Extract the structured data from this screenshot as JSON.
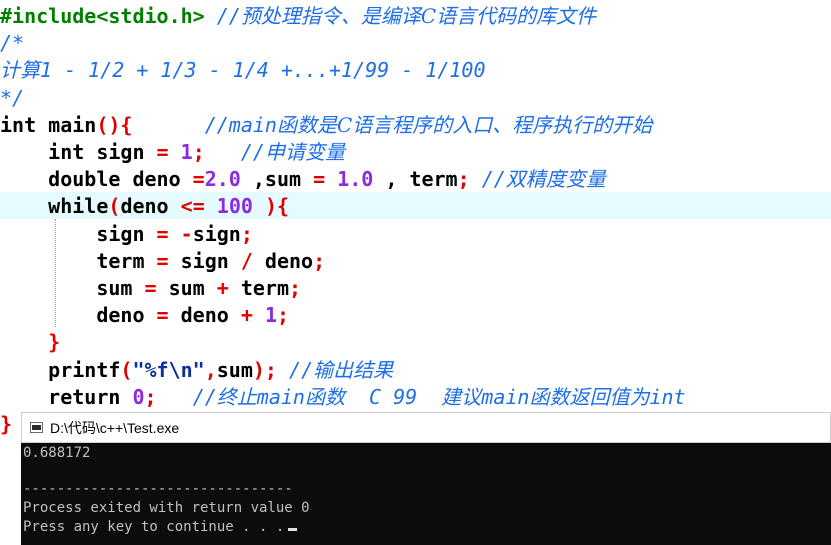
{
  "editor": {
    "lines": [
      {
        "tokens": [
          {
            "c": "pp",
            "t": "#include<stdio.h>"
          },
          {
            "c": "tx",
            "t": " "
          },
          {
            "c": "cm",
            "t": "//"
          },
          {
            "c": "cmz",
            "t": "预处理指令、是编译C语言代码的库文件"
          }
        ]
      },
      {
        "tokens": [
          {
            "c": "cm",
            "t": "/*"
          }
        ]
      },
      {
        "tokens": [
          {
            "c": "cmz",
            "t": "计算"
          },
          {
            "c": "cm",
            "t": "1 - 1/2 + 1/3 - 1/4 +...+1/99 - 1/100"
          }
        ]
      },
      {
        "tokens": [
          {
            "c": "cm",
            "t": "*/"
          }
        ]
      },
      {
        "tokens": [
          {
            "c": "kw",
            "t": "int"
          },
          {
            "c": "tx",
            "t": " main"
          },
          {
            "c": "op",
            "t": "(){"
          },
          {
            "c": "tx",
            "t": "      "
          },
          {
            "c": "cm",
            "t": "//main"
          },
          {
            "c": "cmz",
            "t": "函数是C语言程序的入口、程序执行的开始"
          }
        ]
      },
      {
        "tokens": [
          {
            "c": "tx",
            "t": "    "
          },
          {
            "c": "kw",
            "t": "int"
          },
          {
            "c": "tx",
            "t": " sign "
          },
          {
            "c": "op",
            "t": "="
          },
          {
            "c": "tx",
            "t": " "
          },
          {
            "c": "nm",
            "t": "1"
          },
          {
            "c": "op",
            "t": ";"
          },
          {
            "c": "tx",
            "t": "   "
          },
          {
            "c": "cm",
            "t": "//"
          },
          {
            "c": "cmz",
            "t": "申请变量"
          }
        ]
      },
      {
        "tokens": [
          {
            "c": "tx",
            "t": "    "
          },
          {
            "c": "kw",
            "t": "double"
          },
          {
            "c": "tx",
            "t": " deno "
          },
          {
            "c": "op",
            "t": "="
          },
          {
            "c": "nm",
            "t": "2.0"
          },
          {
            "c": "tx",
            "t": " ,sum "
          },
          {
            "c": "op",
            "t": "="
          },
          {
            "c": "tx",
            "t": " "
          },
          {
            "c": "nm",
            "t": "1.0"
          },
          {
            "c": "tx",
            "t": " , term"
          },
          {
            "c": "op",
            "t": ";"
          },
          {
            "c": "tx",
            "t": " "
          },
          {
            "c": "cm",
            "t": "//"
          },
          {
            "c": "cmz",
            "t": "双精度变量"
          }
        ]
      },
      {
        "tokens": [
          {
            "c": "tx",
            "t": "    "
          },
          {
            "c": "kw",
            "t": "while"
          },
          {
            "c": "op",
            "t": "("
          },
          {
            "c": "tx",
            "t": "deno "
          },
          {
            "c": "op",
            "t": "<="
          },
          {
            "c": "tx",
            "t": " "
          },
          {
            "c": "nm",
            "t": "100"
          },
          {
            "c": "tx",
            "t": " "
          },
          {
            "c": "op",
            "t": "){"
          }
        ]
      },
      {
        "tokens": [
          {
            "c": "tx",
            "t": "        sign "
          },
          {
            "c": "op",
            "t": "="
          },
          {
            "c": "tx",
            "t": " "
          },
          {
            "c": "op",
            "t": "-"
          },
          {
            "c": "tx",
            "t": "sign"
          },
          {
            "c": "op",
            "t": ";"
          }
        ]
      },
      {
        "tokens": [
          {
            "c": "tx",
            "t": "        term "
          },
          {
            "c": "op",
            "t": "="
          },
          {
            "c": "tx",
            "t": " sign "
          },
          {
            "c": "op",
            "t": "/"
          },
          {
            "c": "tx",
            "t": " deno"
          },
          {
            "c": "op",
            "t": ";"
          }
        ]
      },
      {
        "tokens": [
          {
            "c": "tx",
            "t": "        sum "
          },
          {
            "c": "op",
            "t": "="
          },
          {
            "c": "tx",
            "t": " sum "
          },
          {
            "c": "op",
            "t": "+"
          },
          {
            "c": "tx",
            "t": " term"
          },
          {
            "c": "op",
            "t": ";"
          }
        ]
      },
      {
        "tokens": [
          {
            "c": "tx",
            "t": "        deno "
          },
          {
            "c": "op",
            "t": "="
          },
          {
            "c": "tx",
            "t": " deno "
          },
          {
            "c": "op",
            "t": "+"
          },
          {
            "c": "tx",
            "t": " "
          },
          {
            "c": "nm",
            "t": "1"
          },
          {
            "c": "op",
            "t": ";"
          }
        ]
      },
      {
        "tokens": [
          {
            "c": "tx",
            "t": "    "
          },
          {
            "c": "op",
            "t": "}"
          }
        ]
      },
      {
        "tokens": [
          {
            "c": "tx",
            "t": "    printf"
          },
          {
            "c": "op",
            "t": "("
          },
          {
            "c": "st",
            "t": "\"%f\\n\""
          },
          {
            "c": "op",
            "t": ","
          },
          {
            "c": "tx",
            "t": "sum"
          },
          {
            "c": "op",
            "t": ");"
          },
          {
            "c": "tx",
            "t": " "
          },
          {
            "c": "cm",
            "t": "//"
          },
          {
            "c": "cmz",
            "t": "输出结果"
          }
        ]
      },
      {
        "tokens": [
          {
            "c": "tx",
            "t": "    "
          },
          {
            "c": "kw",
            "t": "return"
          },
          {
            "c": "tx",
            "t": " "
          },
          {
            "c": "nm",
            "t": "0"
          },
          {
            "c": "op",
            "t": ";"
          },
          {
            "c": "tx",
            "t": "   "
          },
          {
            "c": "cm",
            "t": "//"
          },
          {
            "c": "cmz",
            "t": "终止"
          },
          {
            "c": "cm",
            "t": "main"
          },
          {
            "c": "cmz",
            "t": "函数"
          },
          {
            "c": "cm",
            "t": "  C 99  "
          },
          {
            "c": "cmz",
            "t": "建议"
          },
          {
            "c": "cm",
            "t": "main"
          },
          {
            "c": "cmz",
            "t": "函数返回值为"
          },
          {
            "c": "cm",
            "t": "int"
          }
        ]
      },
      {
        "tokens": [
          {
            "c": "op",
            "t": "}"
          }
        ]
      }
    ]
  },
  "console": {
    "title": "D:\\代码\\c++\\Test.exe",
    "output": "0.688172",
    "separator": "--------------------------------",
    "exit_message": "Process exited with return value 0",
    "prompt": "Press any key to continue . . ."
  },
  "colors": {
    "preprocessor": "#008000",
    "comment": "#1e6ee8",
    "number": "#8a2be2",
    "operator": "#e00000",
    "string": "#0a2fa0",
    "current_line": "#e6fbff",
    "console_bg": "#0c0c0c",
    "console_text": "#c0c0c0"
  }
}
